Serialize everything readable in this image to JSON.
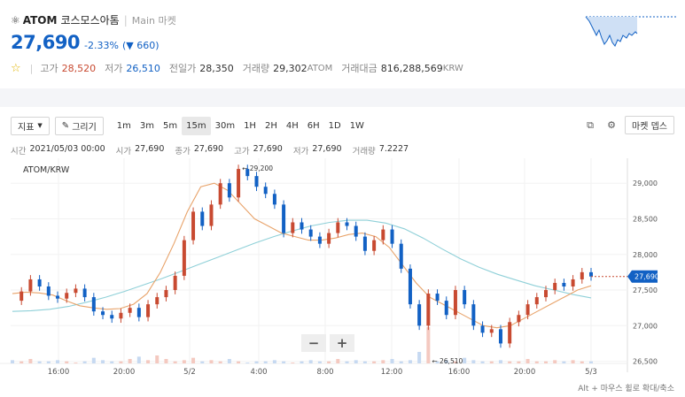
{
  "header": {
    "symbol": "ATOM",
    "name_kr": "코스모스아톰",
    "market_label": "Main 마켓",
    "price": "27,690",
    "change_pct": "-2.33%",
    "change_abs": "660",
    "stats": [
      {
        "label": "고가",
        "value": "28,520",
        "color": "red"
      },
      {
        "label": "저가",
        "value": "26,510",
        "color": "blue"
      },
      {
        "label": "전일가",
        "value": "28,350",
        "color": ""
      },
      {
        "label": "거래량",
        "value": "29,302",
        "unit": "ATOM",
        "color": ""
      },
      {
        "label": "거래대금",
        "value": "816,288,569",
        "unit": "KRW",
        "color": ""
      }
    ]
  },
  "toolbar": {
    "indicator_label": "지표",
    "draw_label": "그리기",
    "intervals": [
      "1m",
      "3m",
      "5m",
      "15m",
      "30m",
      "1H",
      "2H",
      "4H",
      "6H",
      "1D",
      "1W"
    ],
    "active_interval": "15m",
    "market_depth_label": "마켓 뎁스"
  },
  "info_bar": {
    "time_label": "시간",
    "time_value": "2021/05/03 00:00",
    "open_label": "시가",
    "open_value": "27,690",
    "close_label": "종가",
    "close_value": "27,690",
    "high_label": "고가",
    "high_value": "27,690",
    "low_label": "저가",
    "low_value": "27,690",
    "volume_label": "거래량",
    "volume_value": "7.2227"
  },
  "pair_label": "ATOM/KRW",
  "chart_data": {
    "type": "candlestick",
    "y_ticks": [
      "29,000",
      "28,500",
      "28,000",
      "27,500",
      "27,000",
      "26,500"
    ],
    "y_range": [
      26470,
      29350
    ],
    "x_ticks": [
      "16:00",
      "20:00",
      "5/2",
      "4:00",
      "8:00",
      "12:00",
      "16:00",
      "20:00",
      "5/3"
    ],
    "current_price_label": "27,690",
    "high_marker": "29,200",
    "low_marker": "26,510",
    "up_color": "#c84a31",
    "down_color": "#1261c4",
    "ma_fast_color": "#e8a36a",
    "ma_slow_color": "#8fd0d8",
    "price_path": [
      27350,
      27480,
      27650,
      27550,
      27420,
      27380,
      27460,
      27520,
      27400,
      27200,
      27150,
      27100,
      27180,
      27250,
      27120,
      27300,
      27400,
      27500,
      27700,
      28200,
      28600,
      28400,
      28700,
      29000,
      28800,
      29200,
      29100,
      28950,
      28850,
      28700,
      28300,
      28450,
      28350,
      28250,
      28150,
      28300,
      28450,
      28400,
      28250,
      28050,
      28200,
      28350,
      28150,
      27800,
      27300,
      27000,
      27450,
      27350,
      27150,
      27500,
      27300,
      27000,
      26900,
      26950,
      26750,
      27050,
      27150,
      27300,
      27400,
      27500,
      27600,
      27550,
      27650,
      27750,
      27690
    ],
    "ma_fast": [
      27450,
      27470,
      27460,
      27430,
      27350,
      27280,
      27250,
      27230,
      27240,
      27300,
      27450,
      27750,
      28150,
      28600,
      28950,
      29000,
      28900,
      28700,
      28500,
      28400,
      28300,
      28250,
      28200,
      28200,
      28230,
      28280,
      28300,
      28250,
      28100,
      27850,
      27600,
      27400,
      27300,
      27200,
      27100,
      27000,
      26970,
      27000,
      27100,
      27200,
      27300,
      27400,
      27500,
      27560
    ],
    "ma_slow": [
      27200,
      27210,
      27230,
      27270,
      27330,
      27400,
      27480,
      27570,
      27660,
      27760,
      27860,
      27960,
      28060,
      28160,
      28250,
      28330,
      28400,
      28450,
      28480,
      28480,
      28440,
      28360,
      28230,
      28080,
      27940,
      27820,
      27720,
      27640,
      27560,
      27500,
      27440,
      27390
    ],
    "volumes": [
      2,
      1,
      3,
      1,
      1,
      2,
      1,
      0,
      1,
      4,
      2,
      1,
      1,
      3,
      5,
      2,
      6,
      3,
      1,
      2,
      4,
      1,
      2,
      1,
      3,
      1,
      0,
      1,
      1,
      2,
      1,
      0,
      1,
      2,
      1,
      1,
      3,
      1,
      2,
      1,
      1,
      2,
      3,
      1,
      2,
      9,
      30,
      1,
      2,
      1,
      4,
      2,
      1,
      1,
      2,
      1,
      1,
      3,
      1,
      1,
      2,
      1,
      2,
      1,
      1
    ]
  },
  "zoom": {
    "minus": "−",
    "plus": "+"
  },
  "hint": "Alt + 마우스 휠로 확대/축소"
}
